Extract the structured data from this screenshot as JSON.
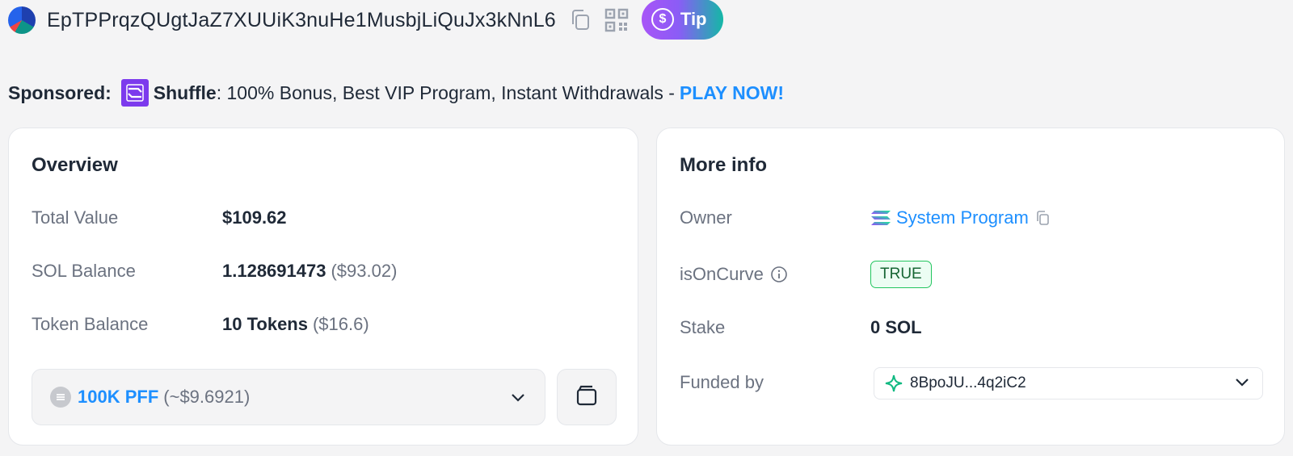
{
  "header": {
    "address": "EpTPPrqzQUgtJaZ7XUUiK3nuHe1MusbjLiQuJx3kNnL6",
    "tip_label": "Tip",
    "tip_symbol": "$"
  },
  "sponsored": {
    "label": "Sponsored:",
    "brand": "Shuffle",
    "description": ": 100% Bonus, Best VIP Program, Instant Withdrawals -",
    "cta": "PLAY NOW!"
  },
  "overview": {
    "title": "Overview",
    "rows": [
      {
        "label": "Total Value",
        "value": "$109.62",
        "sub": ""
      },
      {
        "label": "SOL Balance",
        "value": "1.128691473",
        "sub": "($93.02)"
      },
      {
        "label": "Token Balance",
        "value": "10 Tokens",
        "sub": "($16.6)"
      }
    ],
    "token_select": {
      "name": "100K PFF",
      "value": "(~$9.6921)"
    }
  },
  "more_info": {
    "title": "More info",
    "owner_label": "Owner",
    "owner_value": "System Program",
    "curve_label": "isOnCurve",
    "curve_value": "TRUE",
    "stake_label": "Stake",
    "stake_value": "0 SOL",
    "funded_label": "Funded by",
    "funded_value": "8BpoJU...4q2iC2"
  },
  "colors": {
    "accent": "#1d8fff",
    "true_badge": "#22c55e",
    "shuffle": "#7c3aed"
  }
}
